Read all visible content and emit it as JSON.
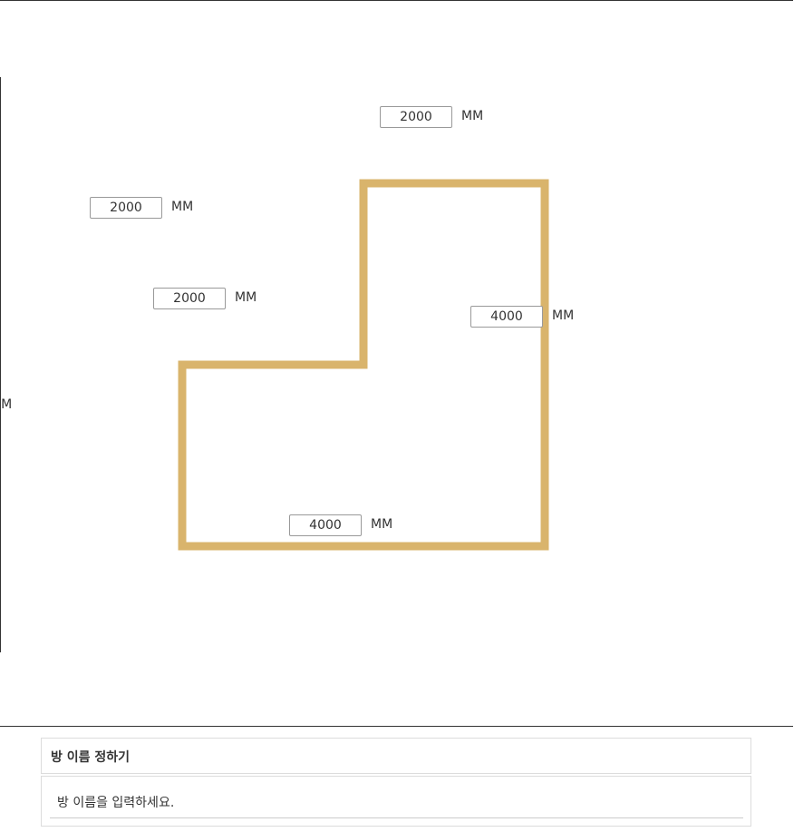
{
  "colors": {
    "wall": "#D9B46C",
    "border": "#333333"
  },
  "room": {
    "unit": "MM",
    "dimensions": {
      "top": "2000",
      "left_upper": "2000",
      "left_step": "2000",
      "right": "4000",
      "bottom": "4000"
    },
    "clipped_left_unit": "MM"
  },
  "room_name_panel": {
    "title": "방 이름 정하기",
    "placeholder": "방 이름을 입력하세요."
  }
}
